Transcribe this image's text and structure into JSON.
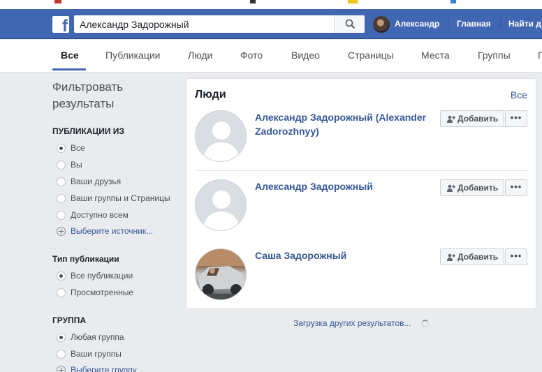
{
  "header": {
    "logo_letter": "f",
    "search_value": "Александр Задорожный",
    "user_name": "Александр",
    "nav_home": "Главная",
    "nav_find_friends": "Найти д"
  },
  "tabs": [
    {
      "label": "Все",
      "active": true
    },
    {
      "label": "Публикации"
    },
    {
      "label": "Люди"
    },
    {
      "label": "Фото"
    },
    {
      "label": "Видео"
    },
    {
      "label": "Страницы"
    },
    {
      "label": "Места"
    },
    {
      "label": "Группы"
    },
    {
      "label": "П"
    }
  ],
  "filters": {
    "title": "Фильтровать результаты",
    "posts_from": {
      "heading": "ПУБЛИКАЦИИ ИЗ",
      "options": [
        "Все",
        "Вы",
        "Ваши друзья",
        "Ваши группы и Страницы",
        "Доступно всем"
      ],
      "selected": "Все",
      "choose_source": "Выберите источник..."
    },
    "post_type": {
      "heading": "Тип публикации",
      "options": [
        "Все публикации",
        "Просмотренные"
      ],
      "selected": "Все публикации"
    },
    "group": {
      "heading": "ГРУППА",
      "options": [
        "Любая группа",
        "Ваши группы"
      ],
      "selected": "Любая группа",
      "choose_group": "Выберите группу"
    }
  },
  "people": {
    "title": "Люди",
    "see_all": "Все",
    "add_label": "Добавить",
    "more_label": "•••",
    "results": [
      {
        "name": "Александр Задорожный (Alexander Zadorozhnyy)",
        "avatar": "default"
      },
      {
        "name": "Александр Задорожный",
        "avatar": "default"
      },
      {
        "name": "Саша Задорожный",
        "avatar": "photo"
      }
    ]
  },
  "loading_text": "Загрузка других результатов...",
  "colors": {
    "brand_blue": "#4267b2",
    "link_blue": "#365899",
    "page_bg": "#e9ebee"
  }
}
